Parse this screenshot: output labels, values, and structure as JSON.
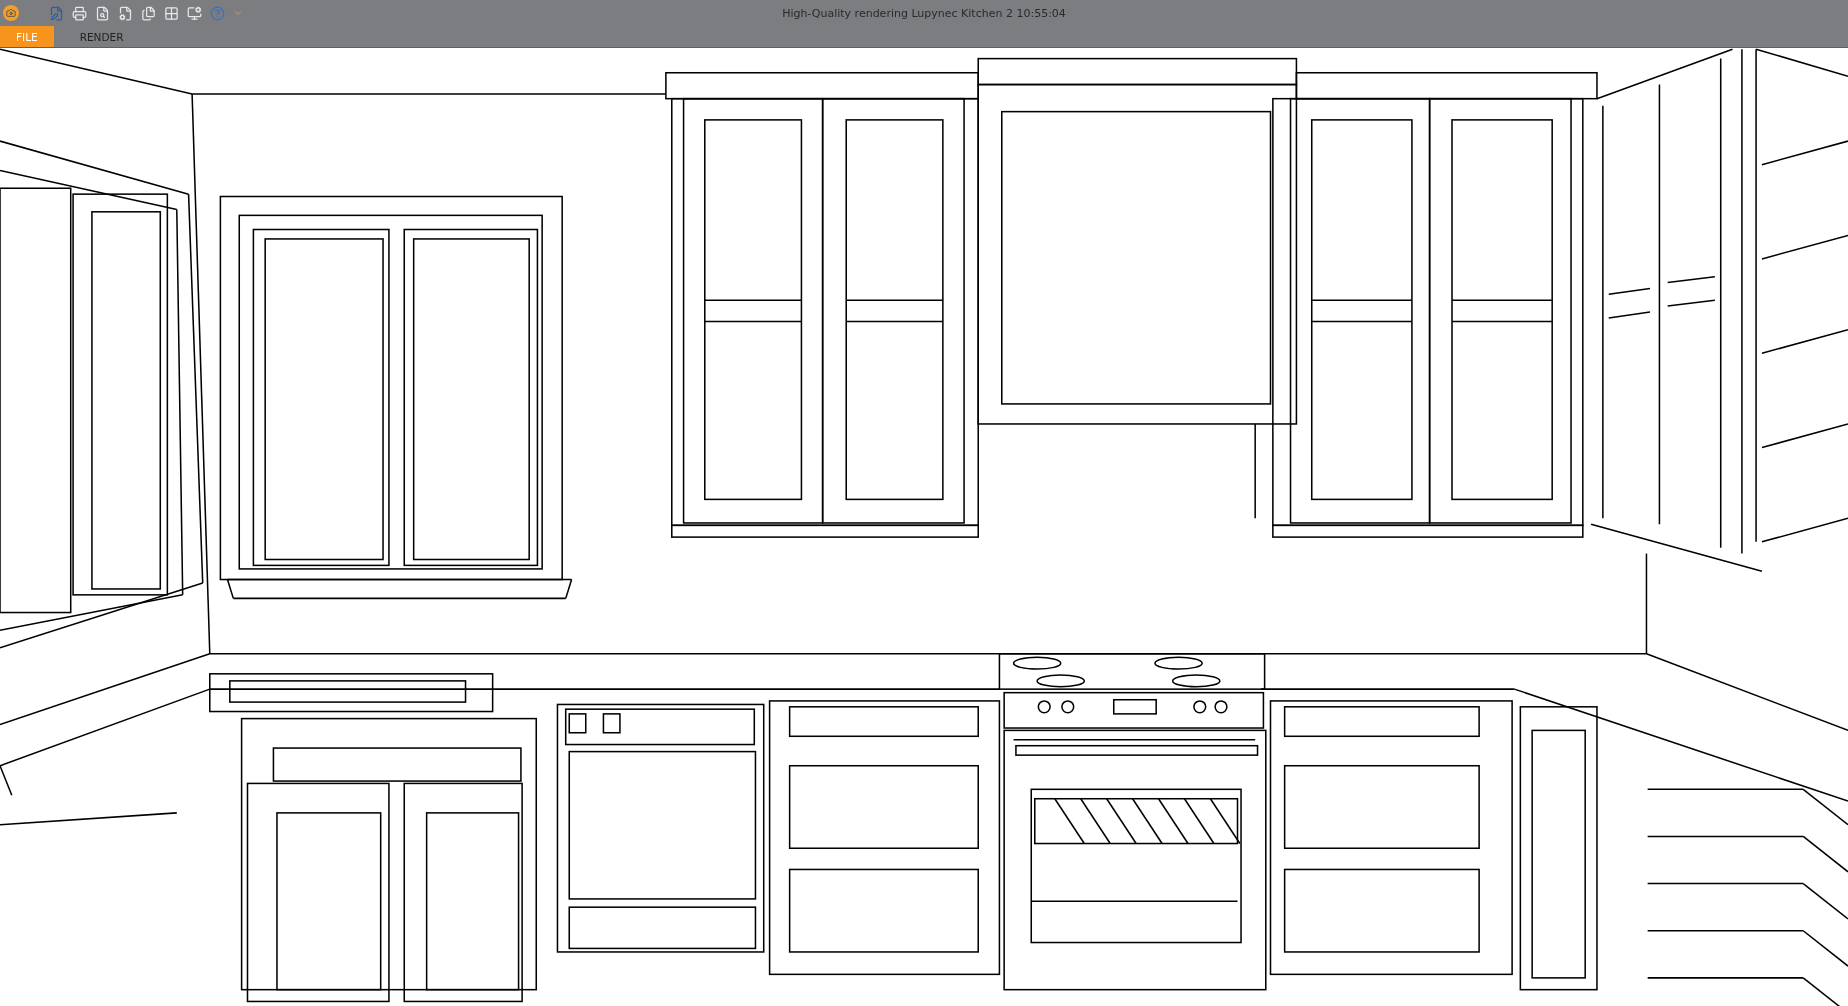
{
  "window": {
    "title": "High-Quality rendering Lupynec Kitchen 2 10:55:04"
  },
  "tabs": [
    {
      "label": "FILE",
      "selected": true
    },
    {
      "label": "RENDER",
      "selected": false
    }
  ]
}
